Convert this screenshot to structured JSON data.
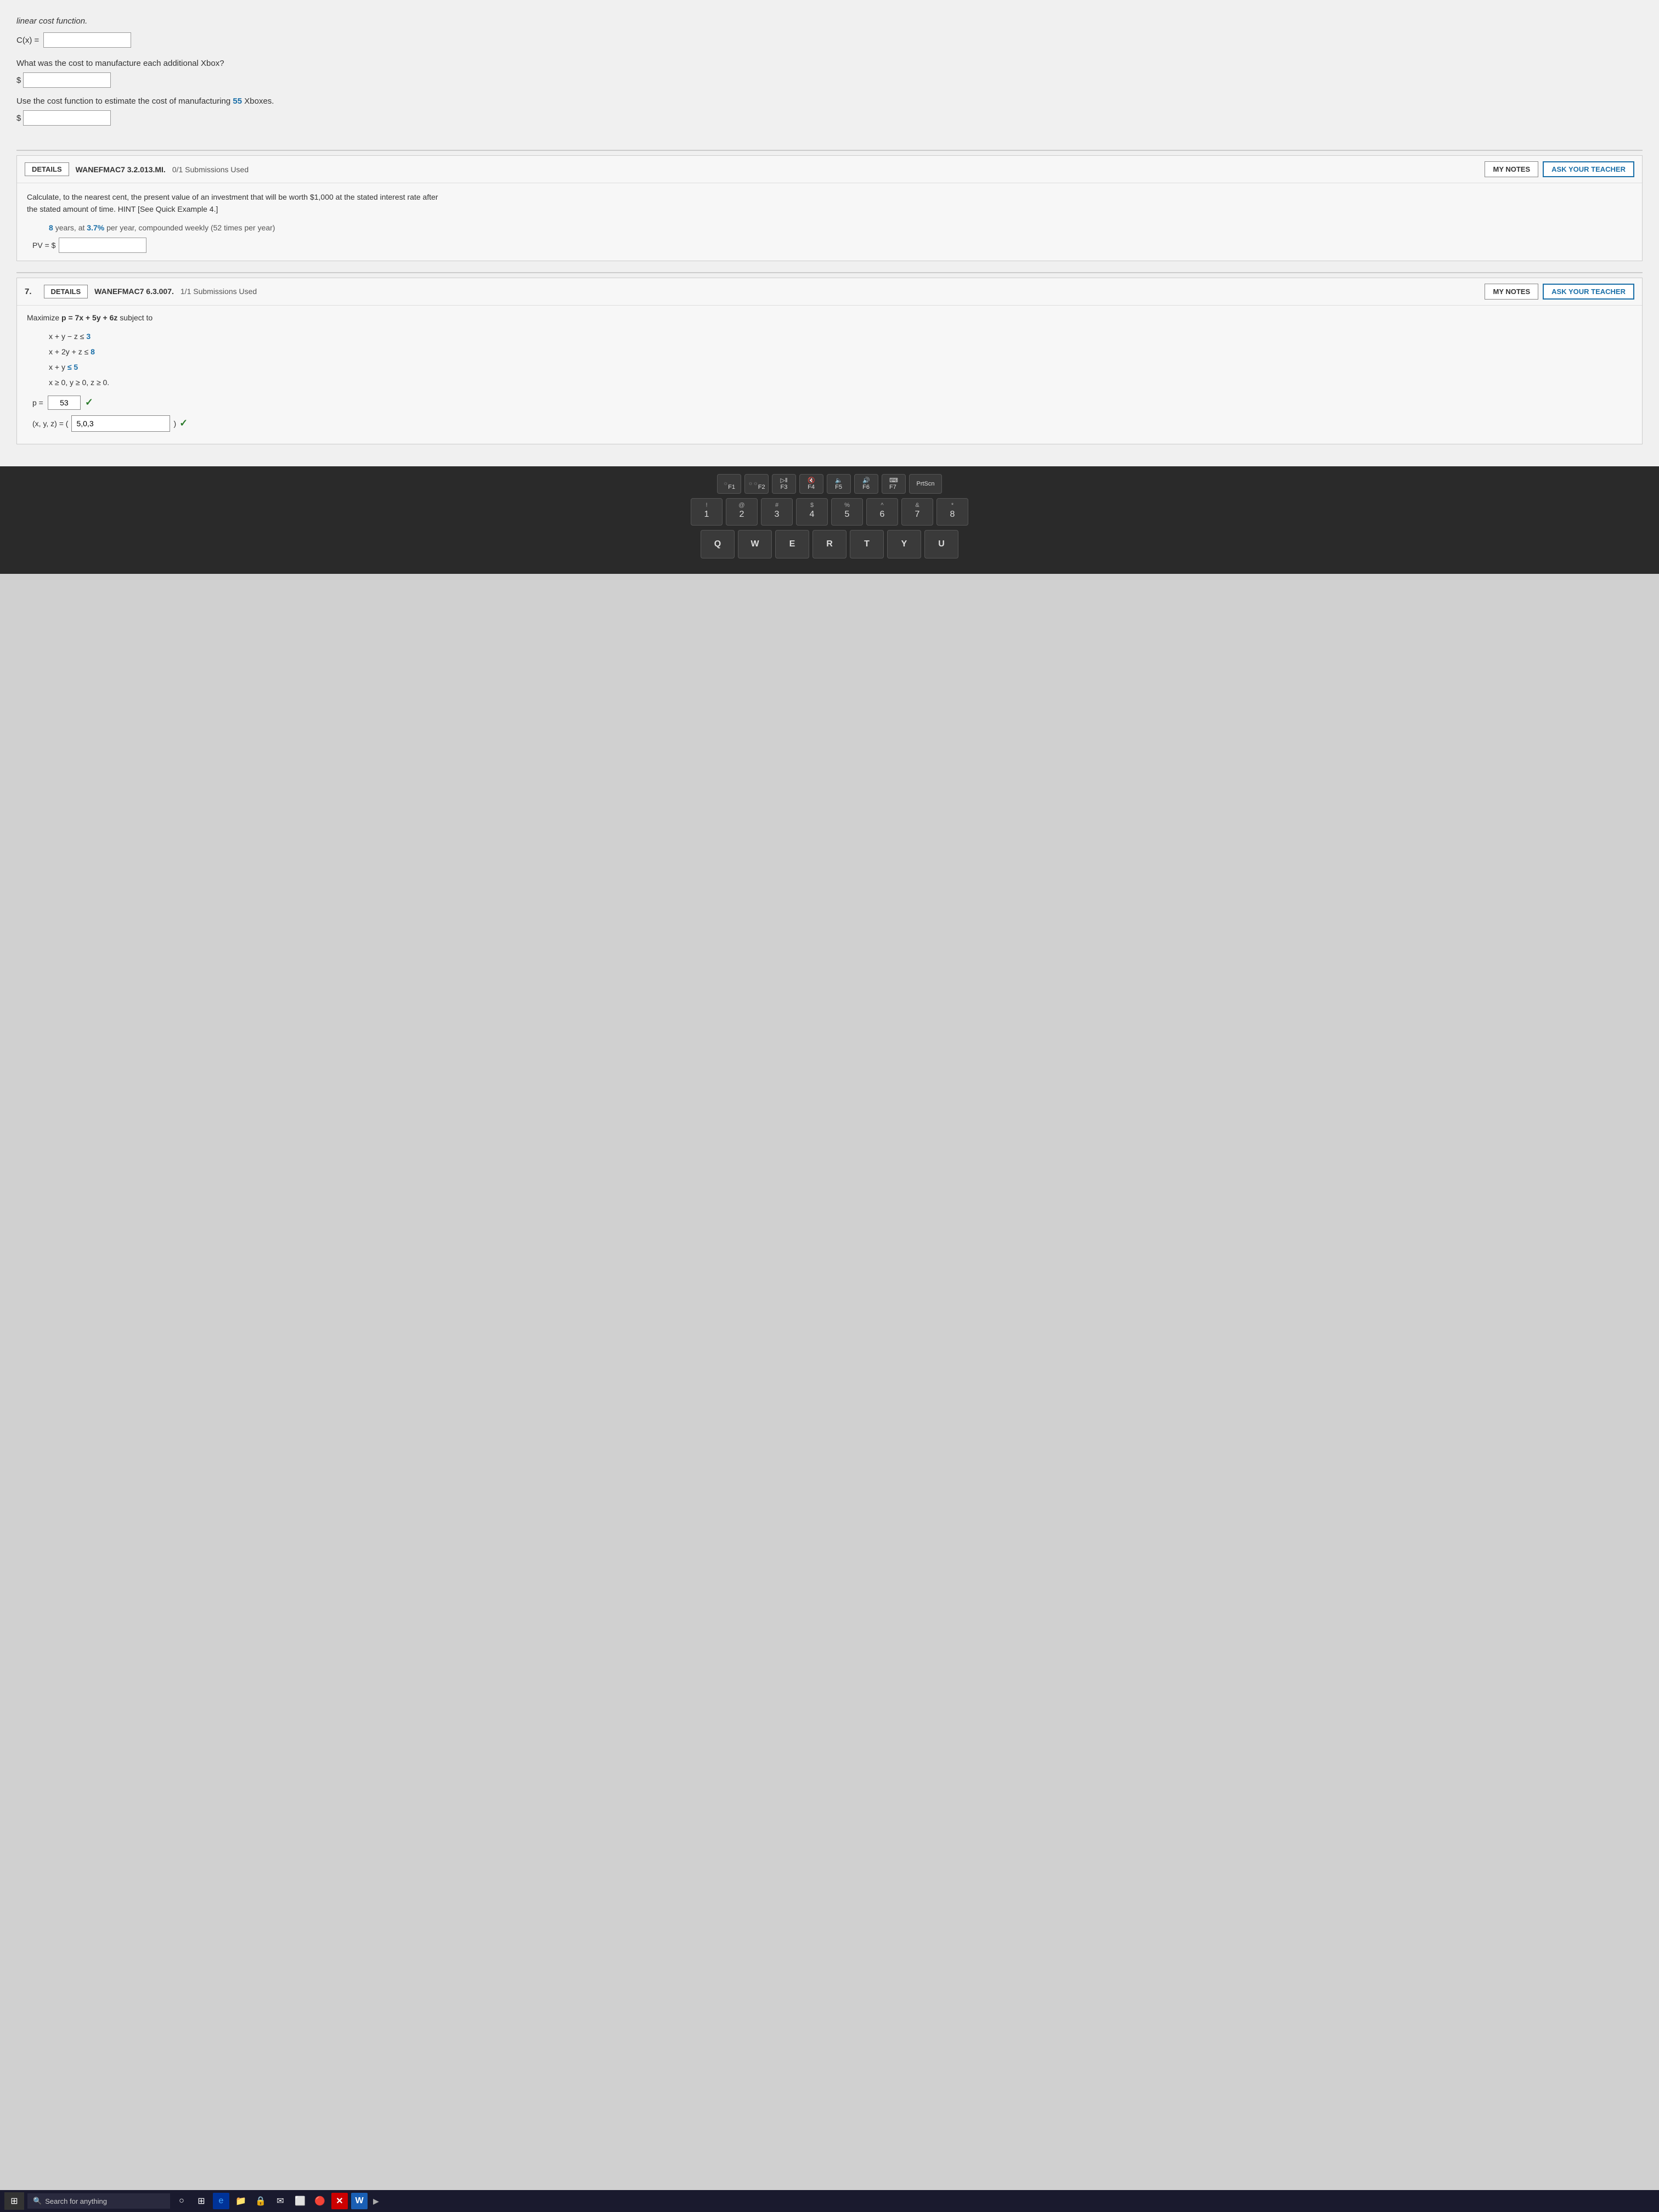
{
  "page": {
    "background": "#d0d0d0"
  },
  "top_section": {
    "title": "linear cost function.",
    "cx_label": "C(x) =",
    "cx_placeholder": "",
    "question1": "What was the cost to manufacture each additional Xbox?",
    "dollar1_label": "$",
    "question2_prefix": "Use the cost function to estimate the cost of manufacturing",
    "question2_highlight": "55",
    "question2_suffix": "Xboxes.",
    "dollar2_label": "$"
  },
  "problem6": {
    "details_label": "DETAILS",
    "problem_id": "WANEFMAC7 3.2.013.MI.",
    "submissions": "0/1 Submissions Used",
    "my_notes_label": "MY NOTES",
    "ask_teacher_label": "ASK YOUR TEACHER",
    "description_line1": "Calculate, to the nearest cent, the present value of an investment that will be worth $1,000 at the stated interest rate after",
    "description_line2": "the stated amount of time. HINT [See Quick Example 4.]",
    "subtext": "8 years, at 3.7% per year, compounded weekly (52 times per year)",
    "pv_label": "PV = $",
    "years_highlight": "8",
    "rate_highlight": "3.7%"
  },
  "problem7": {
    "number": "7.",
    "details_label": "DETAILS",
    "problem_id": "WANEFMAC7 6.3.007.",
    "submissions": "1/1 Submissions Used",
    "my_notes_label": "MY NOTES",
    "ask_teacher_label": "ASK YOUR TEACHER",
    "maximize_label": "Maximize p = 7x + 5y + 6z subject to",
    "constraints": [
      {
        "text": "x  +  y  −  z ≤",
        "value": "3",
        "value_colored": true
      },
      {
        "text": "x  +  2y  +  z ≤",
        "value": "8",
        "value_colored": true
      },
      {
        "text": "x  +  y",
        "value": "≤  5",
        "value_colored": true
      },
      {
        "text": "x ≥ 0, y ≥ 0, z ≥ 0."
      }
    ],
    "p_label": "p =",
    "p_value": "53",
    "xyz_label": "(x, y, z) = (",
    "xyz_value": "5,0,3",
    "xyz_close": ")"
  },
  "taskbar": {
    "search_placeholder": "Search for anything",
    "icons": [
      "⬛",
      "🔲",
      "e",
      "📁",
      "🔒",
      "📧",
      "⬜",
      "🔴",
      "W"
    ]
  },
  "keyboard": {
    "fn_row": [
      "F1",
      "F2",
      "F3",
      "F4",
      "F5",
      "F6",
      "F7",
      "PrtScn"
    ],
    "num_row": [
      {
        "symbol": "!",
        "num": "1"
      },
      {
        "symbol": "@",
        "num": "2"
      },
      {
        "symbol": "#",
        "num": "3"
      },
      {
        "symbol": "$",
        "num": "4"
      },
      {
        "symbol": "%",
        "num": "5"
      },
      {
        "symbol": "^",
        "num": "6"
      },
      {
        "symbol": "&",
        "num": "7"
      },
      {
        "symbol": "*",
        "num": "8"
      }
    ],
    "letter_row": [
      "Q",
      "W",
      "E",
      "R",
      "T",
      "Y",
      "U"
    ]
  }
}
